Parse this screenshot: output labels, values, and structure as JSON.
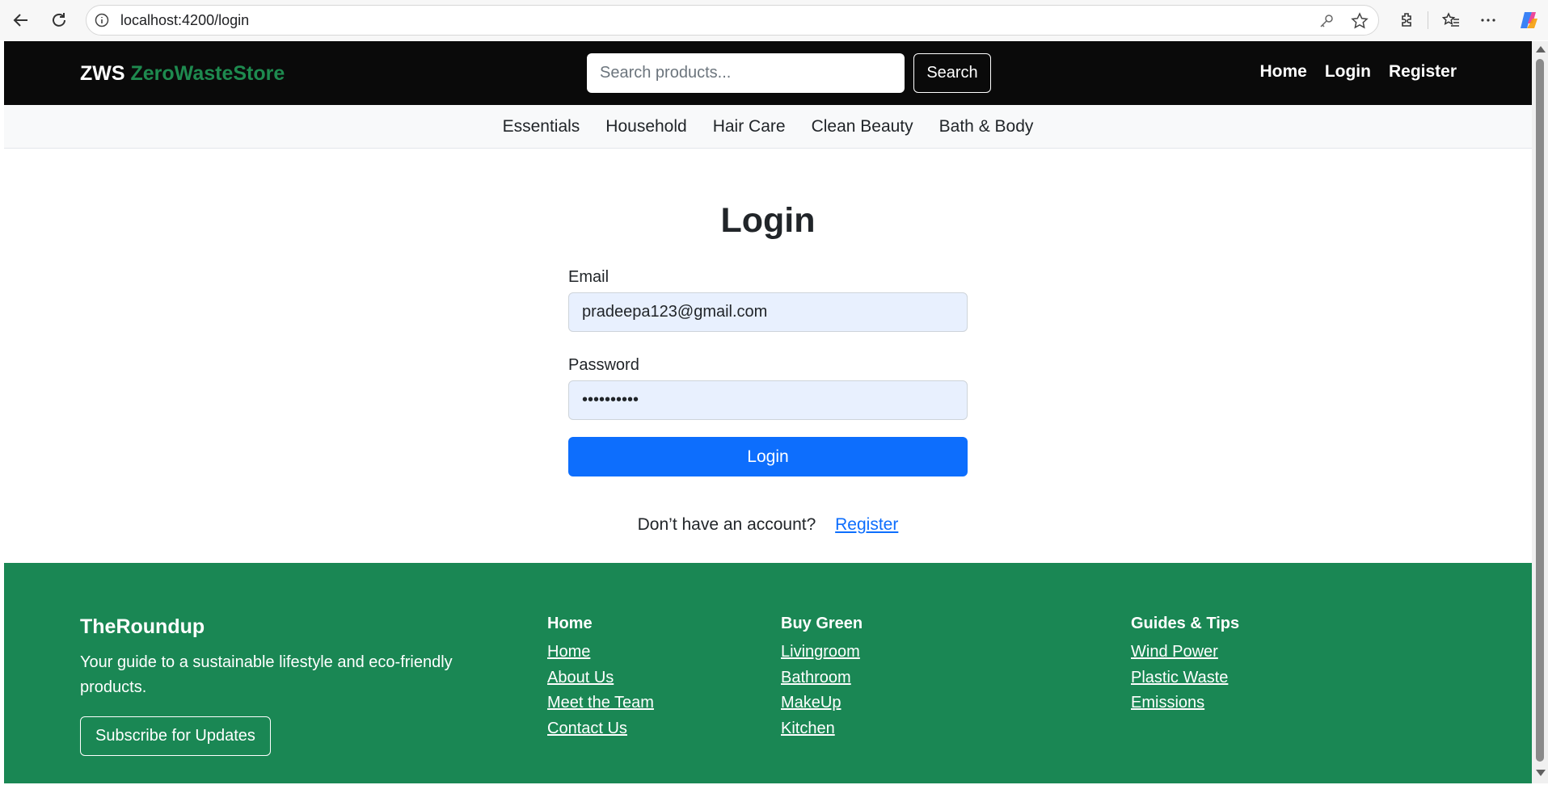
{
  "browser": {
    "url": "localhost:4200/login"
  },
  "header": {
    "brand_short": "ZWS",
    "brand_name": "ZeroWasteStore",
    "search_placeholder": "Search products...",
    "search_button": "Search",
    "links": [
      "Home",
      "Login",
      "Register"
    ]
  },
  "categories": [
    "Essentials",
    "Household",
    "Hair Care",
    "Clean Beauty",
    "Bath & Body"
  ],
  "login": {
    "title": "Login",
    "email_label": "Email",
    "email_value": "pradeepa123@gmail.com",
    "password_label": "Password",
    "password_value": "••••••••••",
    "submit_label": "Login",
    "no_account_text": "Don’t have an account?",
    "register_link": "Register"
  },
  "footer": {
    "brand": "TheRoundup",
    "tagline": "Your guide to a sustainable lifestyle and eco-friendly products.",
    "subscribe_button": "Subscribe for Updates",
    "columns": [
      {
        "title": "Home",
        "links": [
          "Home",
          "About Us",
          "Meet the Team",
          "Contact Us"
        ]
      },
      {
        "title": "Buy Green",
        "links": [
          "Livingroom",
          "Bathroom",
          "MakeUp",
          "Kitchen"
        ]
      },
      {
        "title": "Guides & Tips",
        "links": [
          "Wind Power",
          "Plastic Waste",
          "Emissions"
        ]
      }
    ]
  },
  "colors": {
    "brand_green": "#1e8a4f",
    "footer_green": "#1a8754",
    "primary_blue": "#0d6efd",
    "topbar_black": "#0a0a0a",
    "autofill_blue": "#e8f0fe"
  }
}
